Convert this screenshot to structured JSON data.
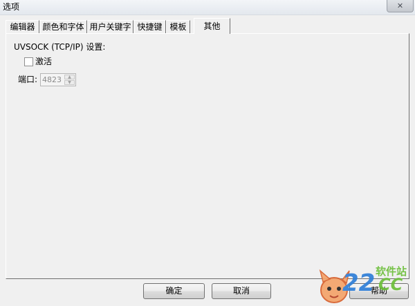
{
  "window": {
    "title": "选项",
    "close_icon": "close-icon"
  },
  "tabs": [
    {
      "label": "编辑器",
      "selected": false
    },
    {
      "label": "颜色和字体",
      "selected": false
    },
    {
      "label": "用户关键字",
      "selected": false
    },
    {
      "label": "快捷键",
      "selected": false
    },
    {
      "label": "模板",
      "selected": false
    },
    {
      "label": "其他",
      "selected": true
    }
  ],
  "uvsock": {
    "group_label": "UVSOCK (TCP/IP) 设置:",
    "activate_label": "激活",
    "activate_checked": false,
    "port_label": "端口:",
    "port_value": "4823",
    "port_enabled": false
  },
  "buttons": {
    "ok": "确定",
    "cancel": "取消",
    "help": "帮助"
  },
  "watermark": {
    "site": "软件站",
    "mark_a": "22",
    "mark_b": "CC"
  },
  "colors": {
    "background": "#f0f0f0",
    "disabled_text": "#8a8a8a",
    "watermark_green": "#6cbf3a",
    "watermark_blue": "#2f7fd8"
  }
}
